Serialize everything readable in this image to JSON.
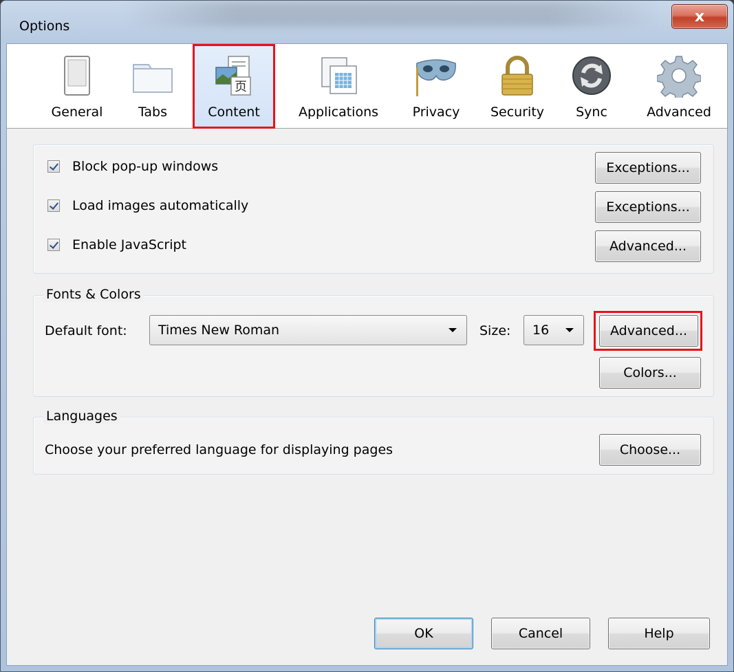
{
  "window": {
    "title": "Options",
    "close_label": "x"
  },
  "toolbar": {
    "items": [
      {
        "label": "General",
        "icon": "general-icon"
      },
      {
        "label": "Tabs",
        "icon": "tabs-icon"
      },
      {
        "label": "Content",
        "icon": "content-icon",
        "selected": true
      },
      {
        "label": "Applications",
        "icon": "applications-icon"
      },
      {
        "label": "Privacy",
        "icon": "privacy-mask-icon"
      },
      {
        "label": "Security",
        "icon": "padlock-icon"
      },
      {
        "label": "Sync",
        "icon": "sync-icon"
      },
      {
        "label": "Advanced",
        "icon": "gear-icon"
      }
    ]
  },
  "general_group": {
    "rows": [
      {
        "label": "Block pop-up windows",
        "checked": true,
        "button": "Exceptions..."
      },
      {
        "label": "Load images automatically",
        "checked": true,
        "button": "Exceptions..."
      },
      {
        "label": "Enable JavaScript",
        "checked": true,
        "button": "Advanced..."
      }
    ]
  },
  "fonts_group": {
    "title": "Fonts & Colors",
    "default_font_label": "Default font:",
    "default_font_value": "Times New Roman",
    "size_label": "Size:",
    "size_value": "16",
    "advanced_button": "Advanced...",
    "colors_button": "Colors..."
  },
  "languages_group": {
    "title": "Languages",
    "description": "Choose your preferred language for displaying pages",
    "choose_button": "Choose..."
  },
  "footer": {
    "ok": "OK",
    "cancel": "Cancel",
    "help": "Help"
  },
  "colors": {
    "highlight_outline": "#e8121a",
    "selected_tab_bg": "#d3e3f7"
  }
}
